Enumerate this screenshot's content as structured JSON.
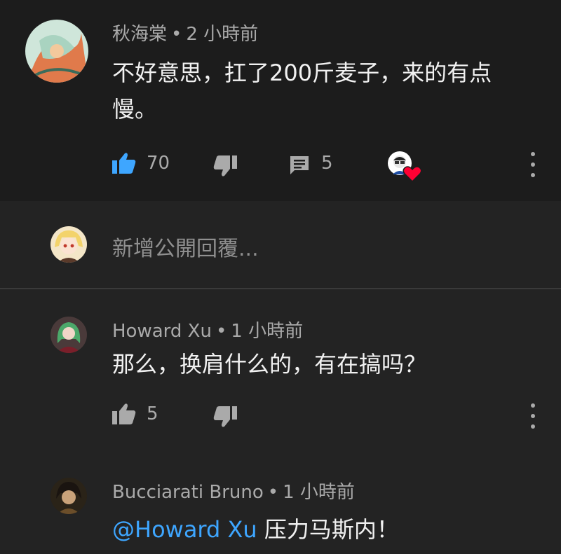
{
  "main_comment": {
    "author": "秋海棠",
    "time": "2 小時前",
    "text_line1": "不好意思，扛了200斤麦子，来的有点",
    "text_line2": "慢。",
    "likes": "70",
    "replies": "5"
  },
  "reply_box": {
    "placeholder": "新增公開回覆..."
  },
  "replies": [
    {
      "author": "Howard Xu",
      "time": "1 小時前",
      "text": "那么，换肩什么的，有在搞吗？",
      "likes": "5"
    },
    {
      "author": "Bucciarati Bruno",
      "time": "1 小時前",
      "mention": "@Howard Xu",
      "text": " 压力马斯内！"
    }
  ],
  "colors": {
    "accent_blue": "#3ea6ff",
    "heart_red": "#ff0033",
    "background": "#232323",
    "panel": "#1c1c1c"
  },
  "icons": {
    "like": "thumbs-up-icon",
    "dislike": "thumbs-down-icon",
    "reply": "comment-icon",
    "creator_heart": "creator-heart-icon",
    "more": "more-vert-icon"
  }
}
